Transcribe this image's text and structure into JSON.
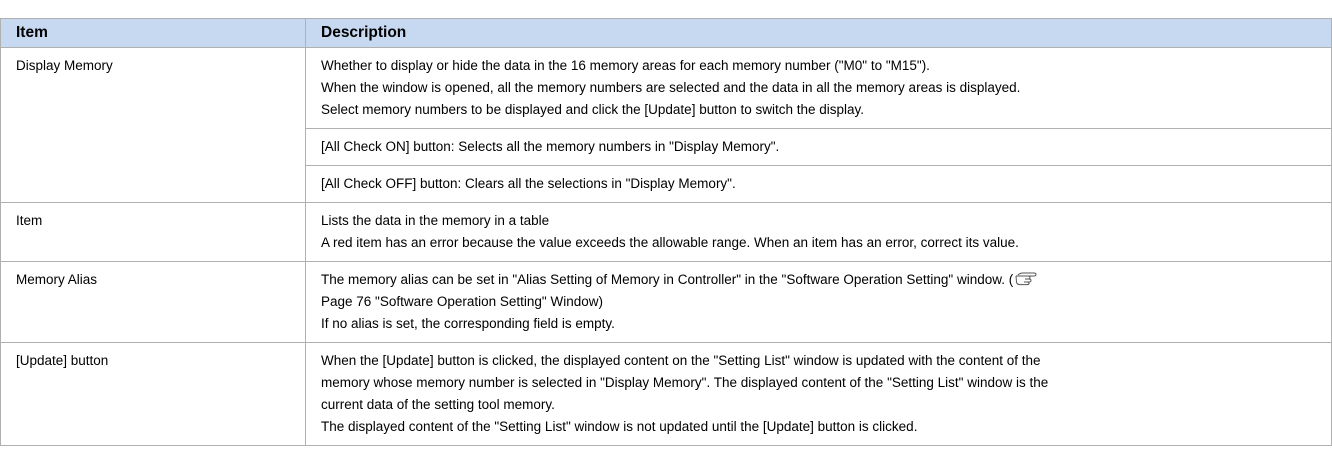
{
  "headers": {
    "item": "Item",
    "description": "Description"
  },
  "rows": [
    {
      "item": "Display Memory",
      "lines": [
        "Whether to display or hide the data in the 16 memory areas for each memory number (\"M0\" to \"M15\").",
        "When the window is opened, all the memory numbers are selected and the data in all the memory areas is displayed.",
        "Select memory numbers to be displayed and click the [Update] button to switch the display."
      ]
    },
    {
      "lines": [
        "[All Check ON] button: Selects all the memory numbers in \"Display Memory\"."
      ]
    },
    {
      "lines": [
        "[All Check OFF] button: Clears all the selections in \"Display Memory\"."
      ]
    },
    {
      "item": "Item",
      "lines": [
        "Lists the data in the memory in a table",
        "A red item has an error because the value exceeds the allowable range. When an item has an error, correct its value."
      ]
    },
    {
      "item": "Memory Alias",
      "line1_a": "The memory alias can be set in \"Alias Setting of Memory in Controller\" in the \"Software Operation Setting\" window. (",
      "line2": "Page 76 \"Software Operation Setting\" Window)",
      "line3": "If no alias is set, the corresponding field is empty."
    },
    {
      "item": "[Update] button",
      "lines": [
        "When the [Update] button is clicked, the displayed content on the \"Setting List\" window is updated with the content of the",
        "memory whose memory number is selected in \"Display Memory\". The displayed content of the \"Setting List\" window is the",
        "current data of the setting tool memory.",
        "The displayed content of the \"Setting List\" window is not updated until the [Update] button is clicked."
      ]
    }
  ],
  "icons": {
    "page_reference": "pointing-hand-icon"
  }
}
